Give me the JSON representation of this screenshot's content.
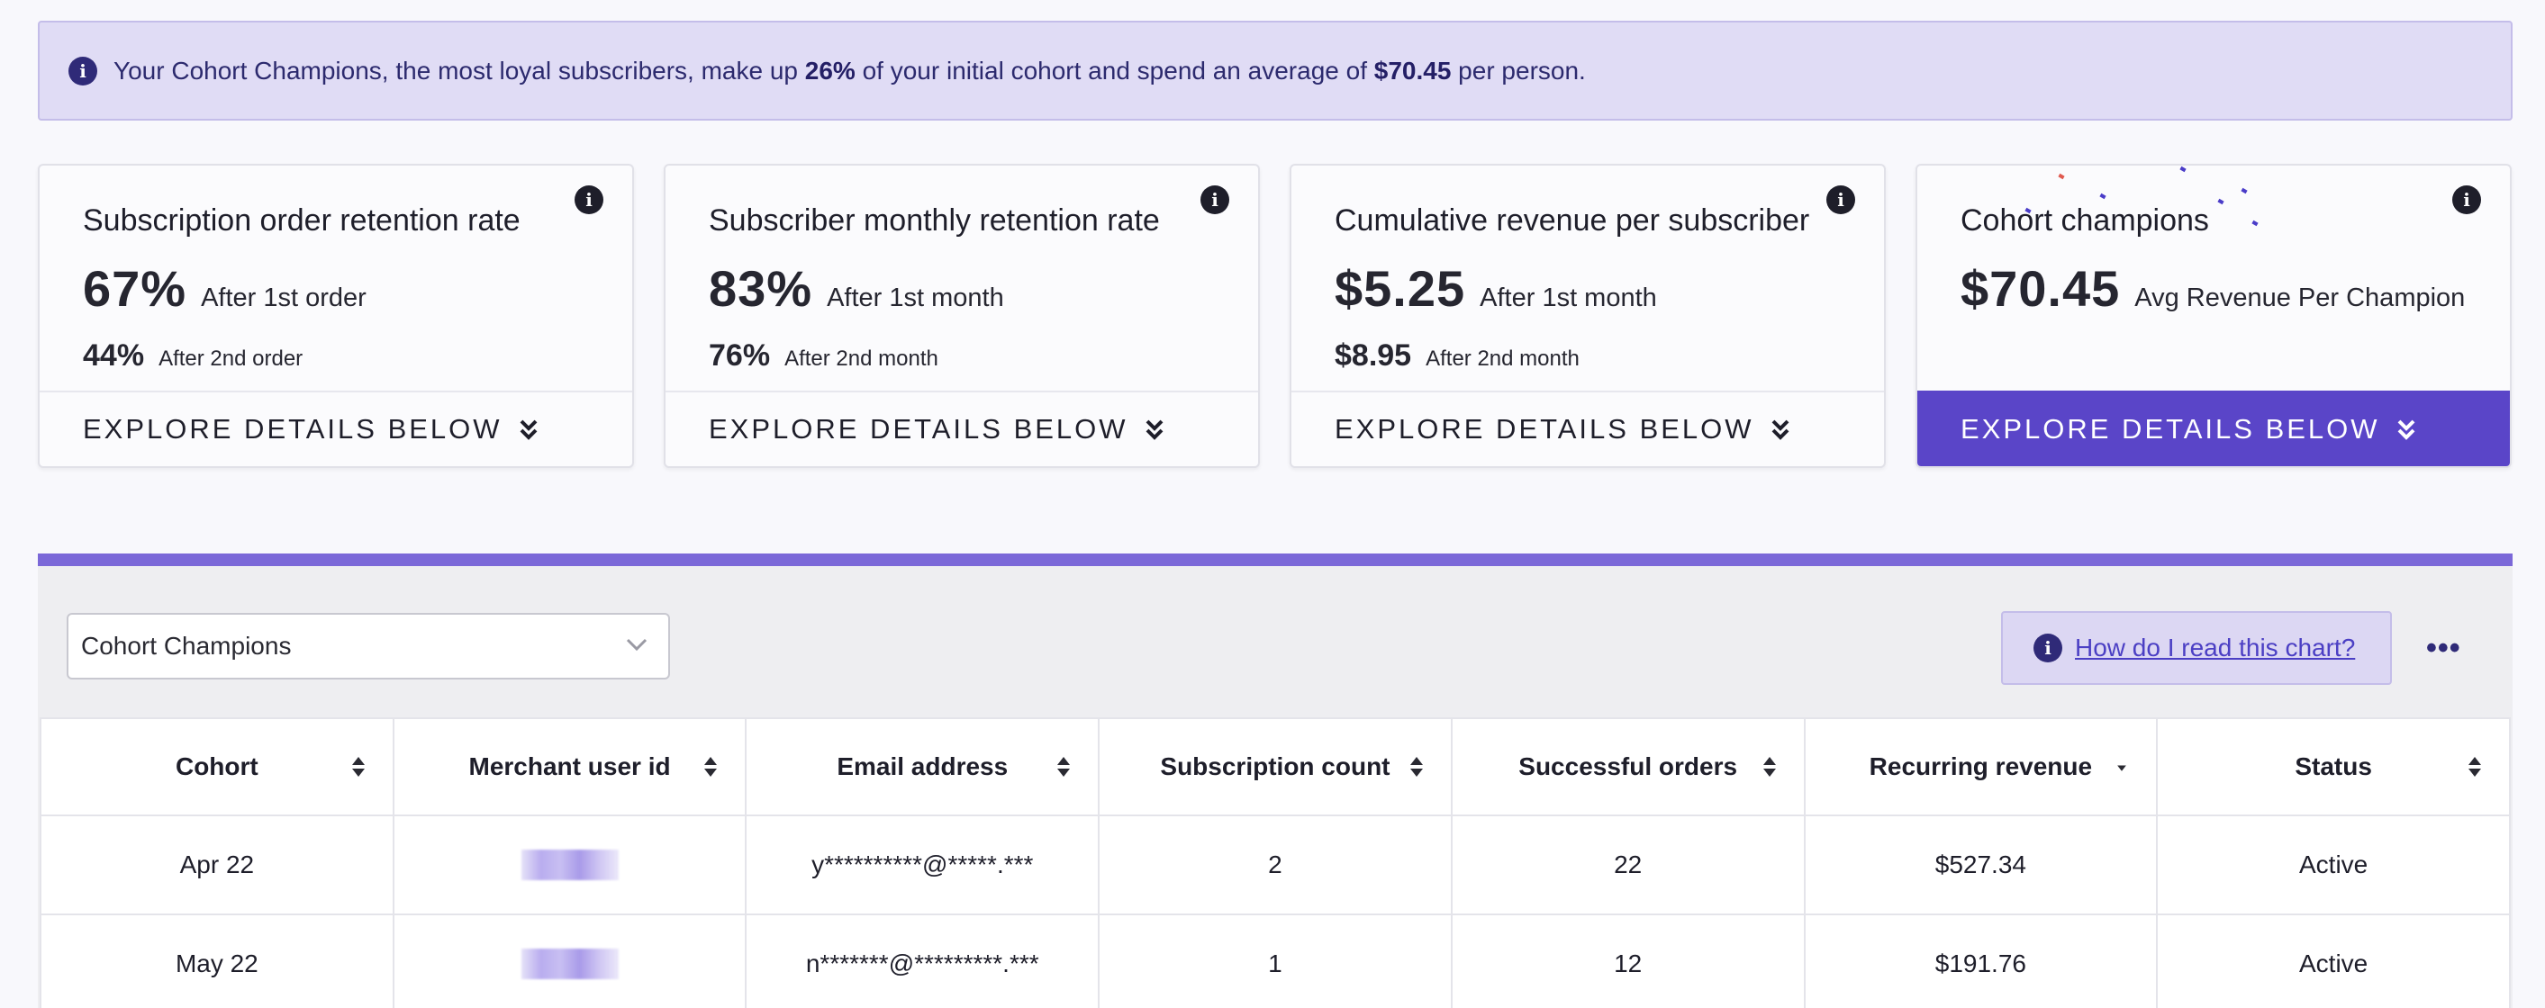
{
  "banner": {
    "icon": "info-icon",
    "text_before": "Your Cohort Champions, the most loyal subscribers, make up ",
    "percent": "26%",
    "text_middle": " of your initial cohort and spend an average of ",
    "amount": "$70.45",
    "text_after": " per person."
  },
  "cards": [
    {
      "title": "Subscription order retention rate",
      "primary_value": "67%",
      "primary_label": "After 1st order",
      "secondary_value": "44%",
      "secondary_label": "After 2nd order",
      "footer": "EXPLORE DETAILS BELOW"
    },
    {
      "title": "Subscriber monthly retention rate",
      "primary_value": "83%",
      "primary_label": "After 1st month",
      "secondary_value": "76%",
      "secondary_label": "After 2nd month",
      "footer": "EXPLORE DETAILS BELOW"
    },
    {
      "title": "Cumulative revenue per subscriber",
      "primary_value": "$5.25",
      "primary_label": "After 1st month",
      "secondary_value": "$8.95",
      "secondary_label": "After 2nd month",
      "footer": "EXPLORE DETAILS BELOW"
    },
    {
      "title": "Cohort champions",
      "primary_value": "$70.45",
      "primary_label": "Avg Revenue Per Champion",
      "footer": "EXPLORE DETAILS BELOW",
      "active": true
    }
  ],
  "table_panel": {
    "select_value": "Cohort Champions",
    "help_text": "How do I read this chart?",
    "more_icon": "ellipsis-icon",
    "columns": [
      "Cohort",
      "Merchant user id",
      "Email address",
      "Subscription count",
      "Successful orders",
      "Recurring revenue",
      "Status"
    ],
    "sorted_column": "Recurring revenue",
    "rows": [
      {
        "cohort": "Apr 22",
        "email": "y**********@*****.***",
        "subscription_count": "2",
        "successful_orders": "22",
        "recurring_revenue": "$527.34",
        "status": "Active"
      },
      {
        "cohort": "May 22",
        "email": "n*******@*********.***",
        "subscription_count": "1",
        "successful_orders": "12",
        "recurring_revenue": "$191.76",
        "status": "Active"
      }
    ]
  },
  "colors": {
    "accent": "#5a45c8",
    "accent_bar": "#7b68d8",
    "banner_bg": "#e0dcf5",
    "info_icon": "#2f2a78"
  }
}
